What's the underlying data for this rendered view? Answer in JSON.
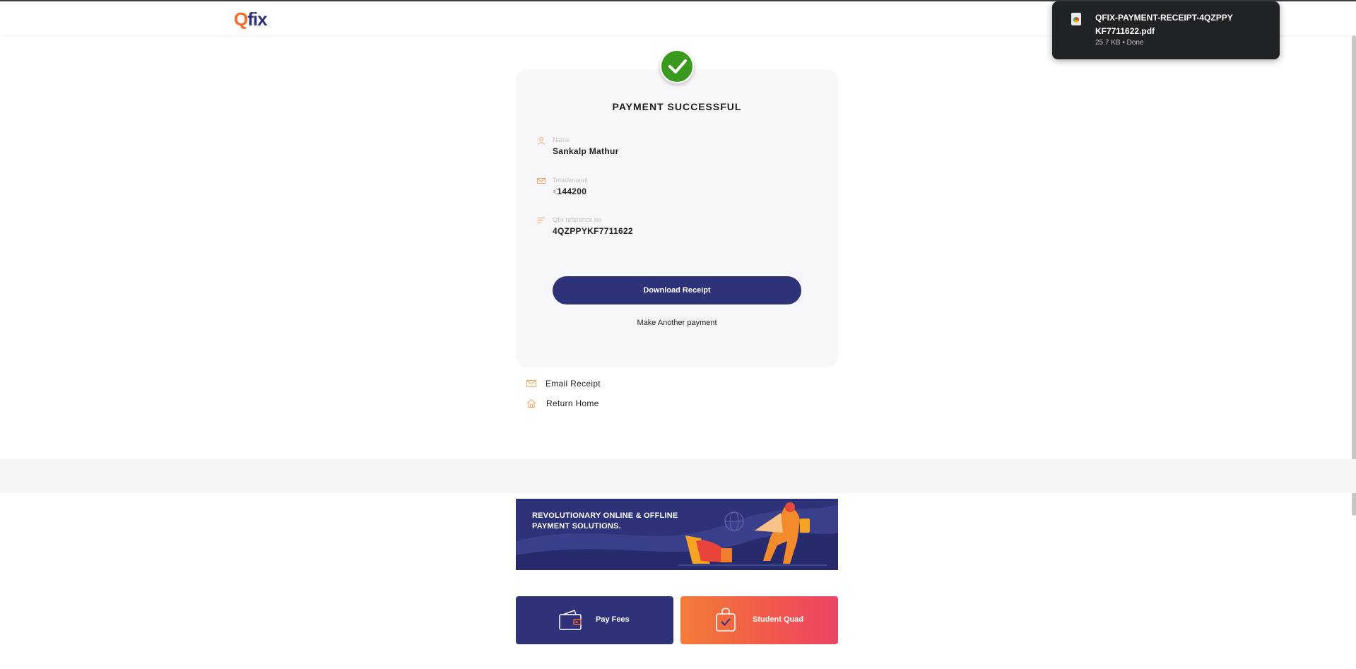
{
  "header": {
    "logo_q": "Q",
    "logo_fix": "fix"
  },
  "card": {
    "title": "PAYMENT SUCCESSFUL",
    "fields": [
      {
        "label": "Name",
        "value": "Sankalp Mathur"
      },
      {
        "label": "TotalAmount",
        "currency": "₹",
        "value": "144200"
      },
      {
        "label": "Qfix reference no",
        "value": "4QZPPYKF7711622"
      }
    ],
    "download_label": "Download Receipt",
    "another_label": "Make Another payment"
  },
  "links": {
    "email": "Email Receipt",
    "home": "Return Home"
  },
  "banner": {
    "headline_line1": "REVOLUTIONARY ONLINE & OFFLINE",
    "headline_line2": "PAYMENT SOLUTIONS."
  },
  "tiles": {
    "pay_fees": "Pay Fees",
    "student_quad": "Student Quad"
  },
  "download_popup": {
    "filename": "QFIX-PAYMENT-RECEIPT-4QZPPYKF7711622.pdf",
    "meta": "25.7 KB • Done"
  },
  "colors": {
    "brand_navy": "#2e3279",
    "brand_orange": "#f26b2a",
    "success_green": "#3a9a1f",
    "accent_orange_icon": "#f5a15a"
  },
  "icons": [
    "check-icon",
    "user-icon",
    "envelope-icon",
    "list-icon",
    "home-icon",
    "wallet-icon",
    "shopping-bag-icon",
    "file-icon",
    "globe-icon"
  ]
}
